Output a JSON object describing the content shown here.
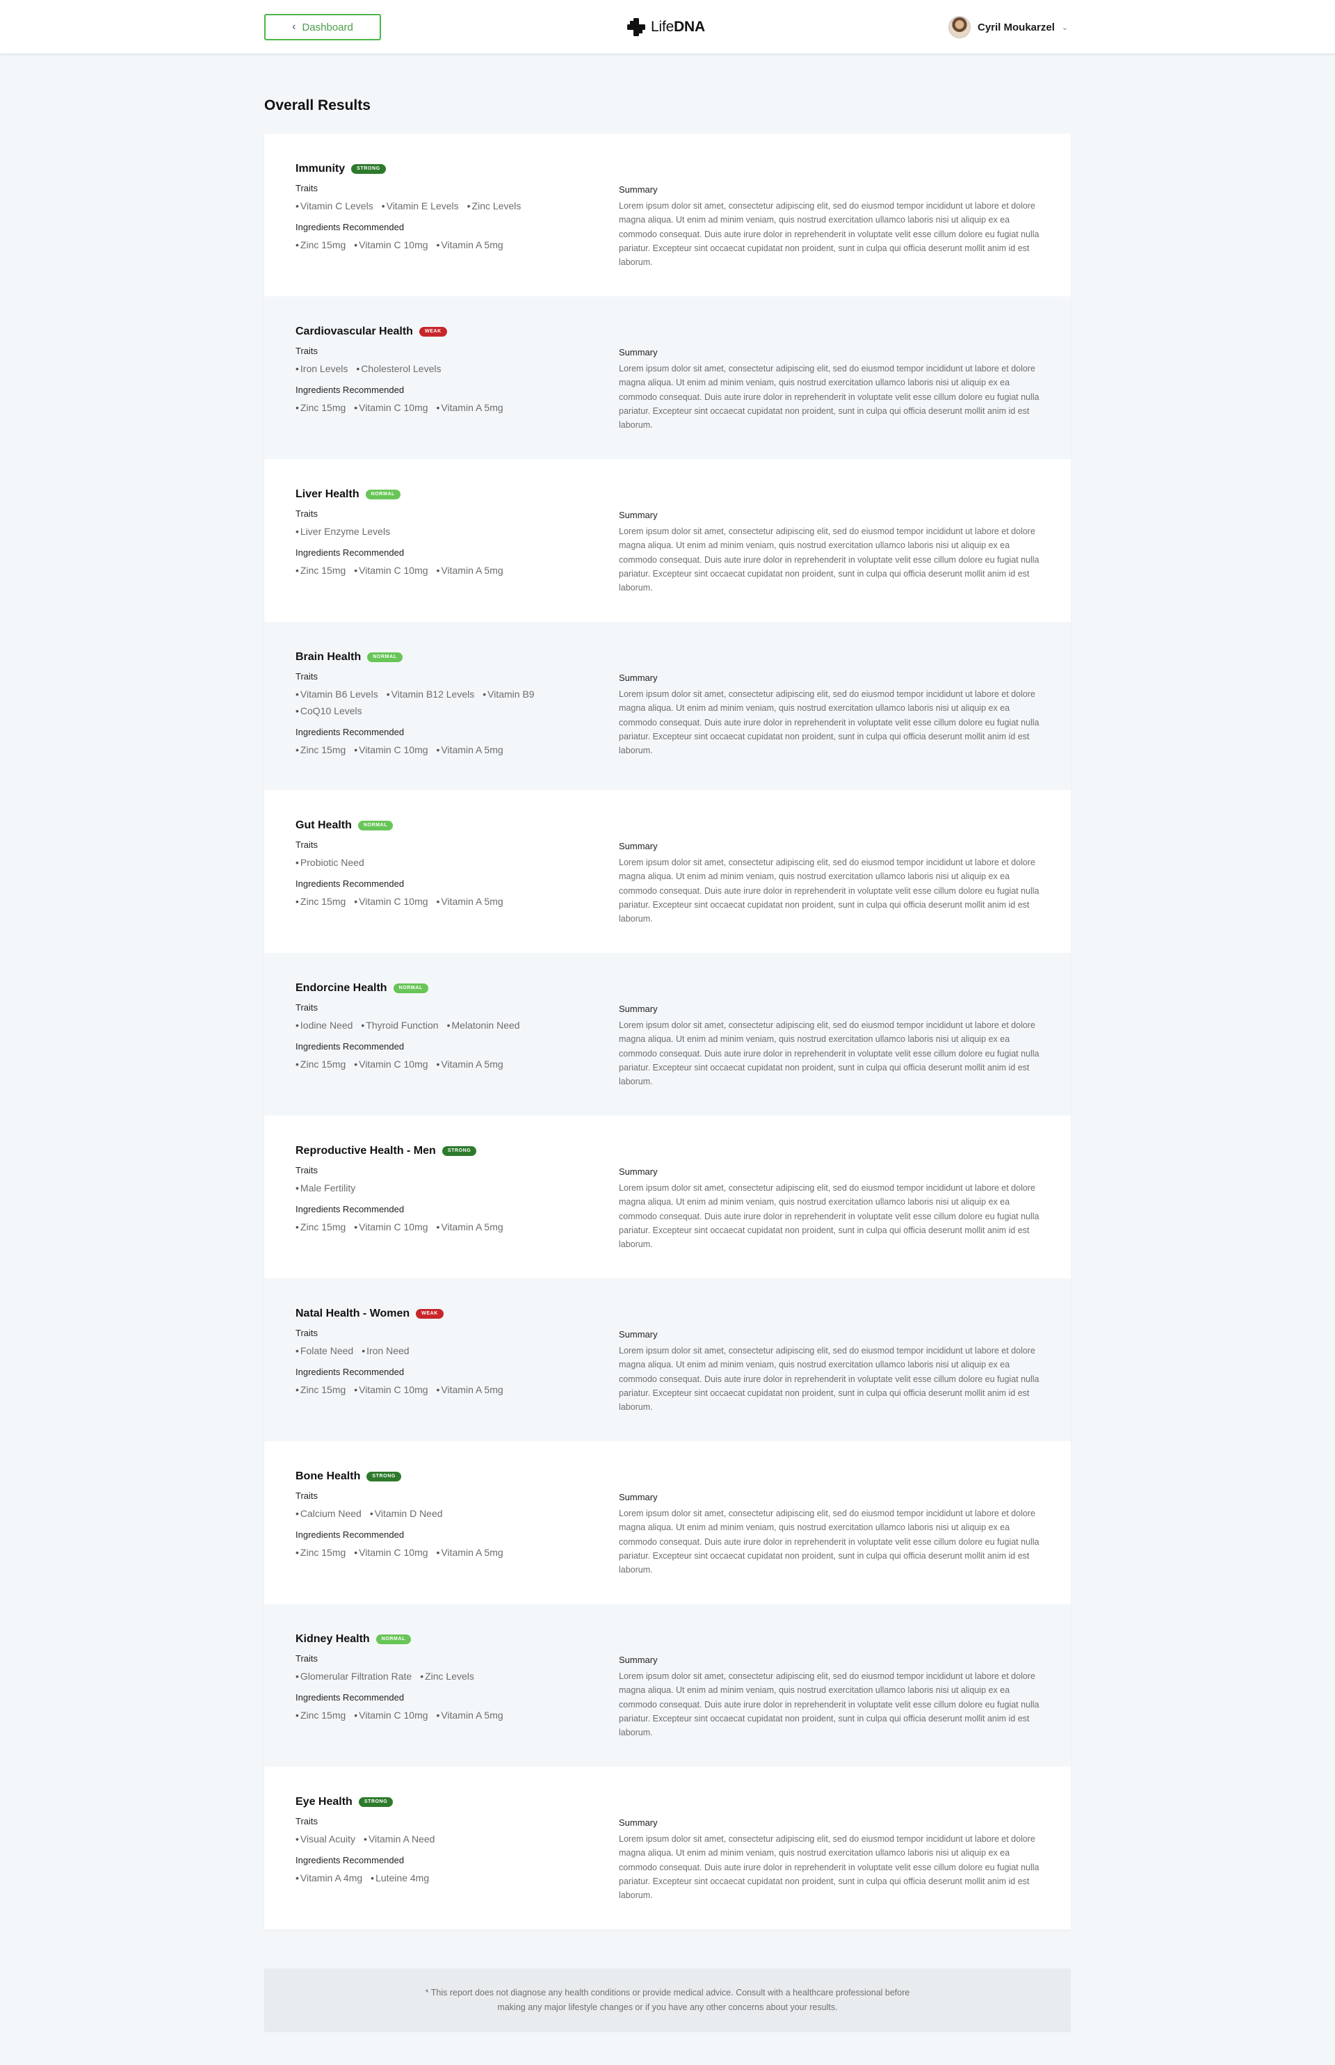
{
  "header": {
    "back_label": "Dashboard",
    "logo_text_light": "Life",
    "logo_text_bold": "DNA",
    "user_name": "Cyril Moukarzel"
  },
  "page_title": "Overall Results",
  "labels": {
    "traits": "Traits",
    "ingredients": "Ingredients Recommended",
    "summary": "Summary"
  },
  "summary_text": "Lorem ipsum dolor sit amet, consectetur adipiscing elit, sed do eiusmod tempor incididunt ut labore et dolore magna aliqua. Ut enim ad minim veniam, quis nostrud exercitation ullamco laboris nisi ut aliquip ex ea commodo consequat. Duis aute irure dolor in reprehenderit in voluptate velit esse cillum dolore eu fugiat nulla pariatur. Excepteur sint occaecat cupidatat non proident, sunt in culpa qui officia deserunt mollit anim id est laborum.",
  "results": [
    {
      "title": "Immunity",
      "status": "STRONG",
      "traits": [
        "Vitamin C Levels",
        "Vitamin E Levels",
        "Zinc Levels"
      ],
      "ingredients": [
        "Zinc 15mg",
        "Vitamin C 10mg",
        "Vitamin A 5mg"
      ]
    },
    {
      "title": "Cardiovascular Health",
      "status": "WEAK",
      "traits": [
        "Iron Levels",
        "Cholesterol Levels"
      ],
      "ingredients": [
        "Zinc 15mg",
        "Vitamin C 10mg",
        "Vitamin A 5mg"
      ]
    },
    {
      "title": "Liver Health",
      "status": "NORMAL",
      "traits": [
        "Liver Enzyme Levels"
      ],
      "ingredients": [
        "Zinc 15mg",
        "Vitamin C 10mg",
        "Vitamin A 5mg"
      ]
    },
    {
      "title": "Brain Health",
      "status": "NORMAL",
      "traits": [
        "Vitamin B6 Levels",
        "Vitamin B12 Levels",
        "Vitamin B9",
        "CoQ10 Levels"
      ],
      "ingredients": [
        "Zinc 15mg",
        "Vitamin C 10mg",
        "Vitamin A 5mg"
      ]
    },
    {
      "title": "Gut Health",
      "status": "NORMAL",
      "traits": [
        "Probiotic Need"
      ],
      "ingredients": [
        "Zinc 15mg",
        "Vitamin C 10mg",
        "Vitamin A 5mg"
      ]
    },
    {
      "title": "Endorcine Health",
      "status": "NORMAL",
      "traits": [
        "Iodine Need",
        "Thyroid Function",
        "Melatonin Need"
      ],
      "ingredients": [
        "Zinc 15mg",
        "Vitamin C 10mg",
        "Vitamin A 5mg"
      ]
    },
    {
      "title": "Reproductive Health - Men",
      "status": "STRONG",
      "traits": [
        "Male Fertility"
      ],
      "ingredients": [
        "Zinc 15mg",
        "Vitamin C 10mg",
        "Vitamin A 5mg"
      ]
    },
    {
      "title": "Natal Health - Women",
      "status": "WEAK",
      "traits": [
        "Folate Need",
        "Iron Need"
      ],
      "ingredients": [
        "Zinc 15mg",
        "Vitamin C 10mg",
        "Vitamin A 5mg"
      ]
    },
    {
      "title": "Bone Health",
      "status": "STRONG",
      "traits": [
        "Calcium Need",
        "Vitamin D Need"
      ],
      "ingredients": [
        "Zinc 15mg",
        "Vitamin C 10mg",
        "Vitamin A 5mg"
      ]
    },
    {
      "title": "Kidney Health",
      "status": "NORMAL",
      "traits": [
        "Glomerular Filtration Rate",
        "Zinc Levels"
      ],
      "ingredients": [
        "Zinc 15mg",
        "Vitamin C 10mg",
        "Vitamin A 5mg"
      ]
    },
    {
      "title": "Eye Health",
      "status": "STRONG",
      "traits": [
        "Visual Acuity",
        "Vitamin A Need"
      ],
      "ingredients": [
        "Vitamin A 4mg",
        "Luteine 4mg"
      ]
    }
  ],
  "disclaimer": "* This report does not diagnose any health conditions or provide medical advice. Consult with a healthcare professional before making any major lifestyle changes or if you have any other concerns about your results.",
  "colors": {
    "accent_green": "#4cb548",
    "strong": "#2e7a2c",
    "weak": "#c8262b",
    "normal": "#68c557"
  }
}
